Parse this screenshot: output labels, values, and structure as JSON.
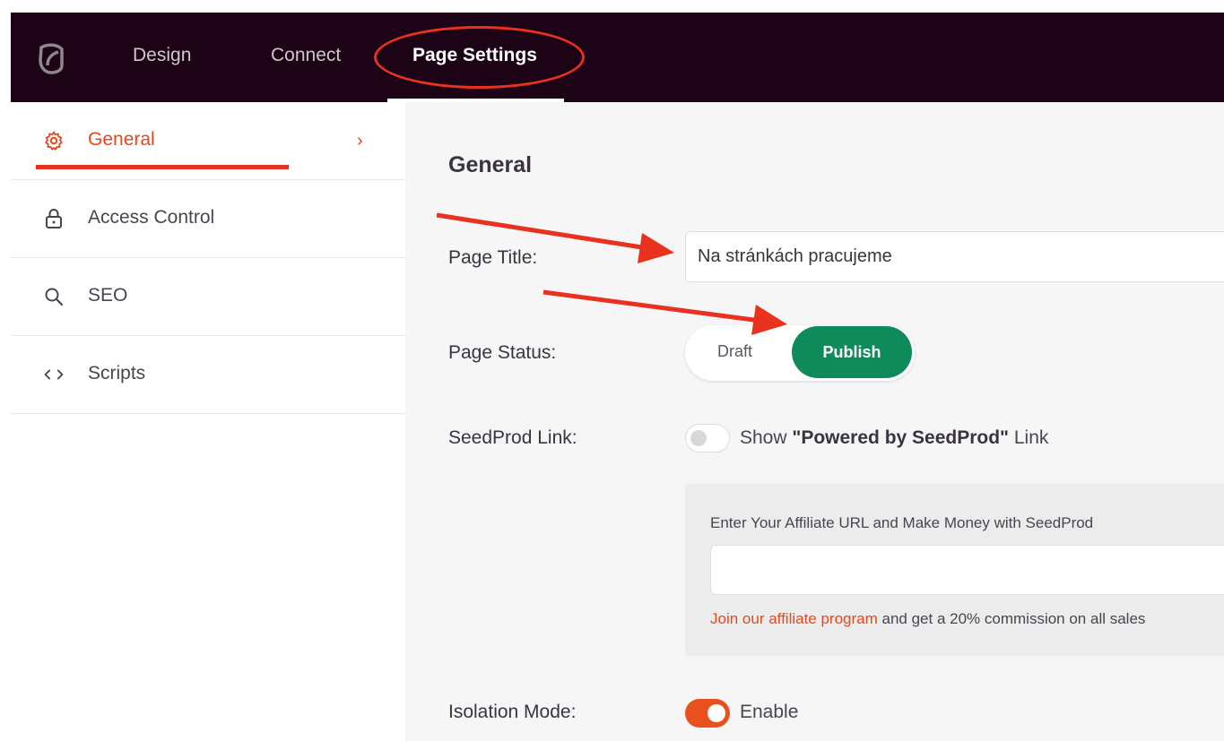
{
  "topbar": {
    "tabs": [
      {
        "label": "Design"
      },
      {
        "label": "Connect"
      },
      {
        "label": "Page Settings",
        "active": true
      }
    ]
  },
  "sidebar": {
    "items": [
      {
        "label": "General",
        "icon": "gear-icon",
        "active": true
      },
      {
        "label": "Access Control",
        "icon": "lock-icon"
      },
      {
        "label": "SEO",
        "icon": "search-icon"
      },
      {
        "label": "Scripts",
        "icon": "code-icon"
      }
    ]
  },
  "main": {
    "heading": "General",
    "page_title": {
      "label": "Page Title:",
      "value": "Na stránkách pracujeme"
    },
    "page_status": {
      "label": "Page Status:",
      "options": [
        "Draft",
        "Publish"
      ],
      "selected": "Publish"
    },
    "seedprod_link": {
      "label": "SeedProd Link:",
      "prefix": "Show ",
      "bold": "\"Powered by SeedProd\"",
      "suffix": " Link",
      "enabled": false
    },
    "affiliate": {
      "label": "Enter Your Affiliate URL and Make Money with SeedProd",
      "value": "",
      "link_text": "Join our affiliate program",
      "note": " and get a 20% commission on all sales"
    },
    "isolation_mode": {
      "label": "Isolation Mode:",
      "toggle_label": "Enable",
      "enabled": true
    }
  },
  "colors": {
    "accent": "#e8471c",
    "topbar_bg": "#1c0316",
    "publish_green": "#0f8a5b",
    "annotation_red": "#e8311f"
  }
}
